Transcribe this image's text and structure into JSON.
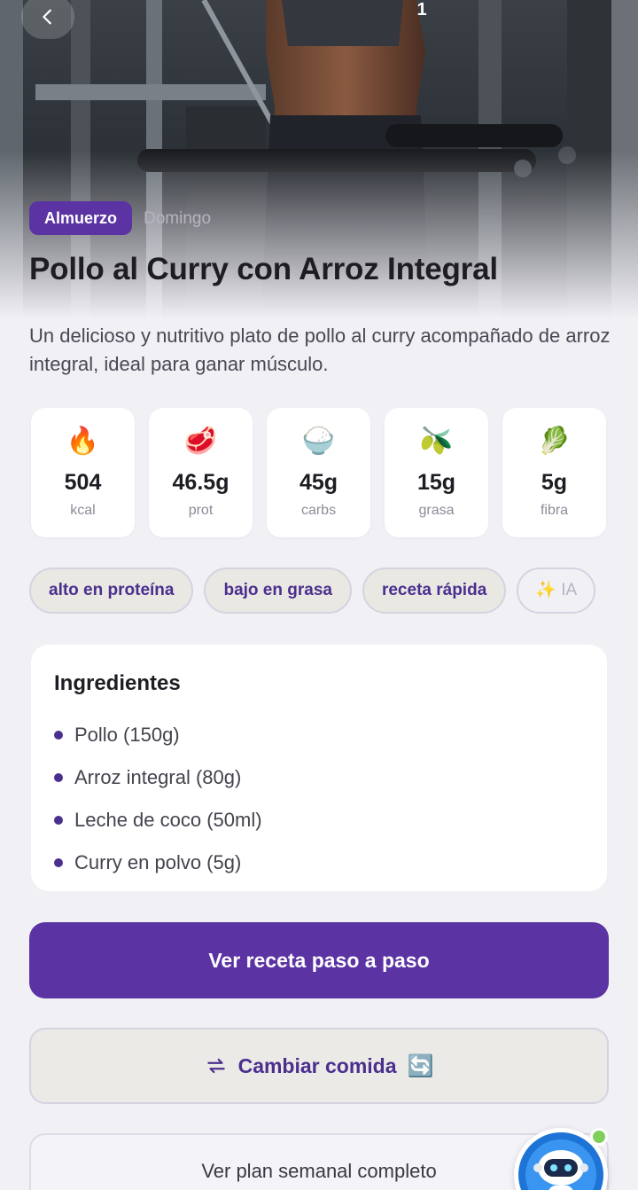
{
  "hero": {
    "page_indicator": "1",
    "meal_type": "Almuerzo",
    "day": "Domingo",
    "title": "Pollo al Curry con Arroz Integral"
  },
  "description": "Un delicioso y nutritivo plato de pollo al curry acompañado de arroz integral, ideal para ganar músculo.",
  "macros": [
    {
      "emoji": "🔥",
      "value": "504",
      "unit": "kcal"
    },
    {
      "emoji": "🥩",
      "value": "46.5g",
      "unit": "prot"
    },
    {
      "emoji": "🍚",
      "value": "45g",
      "unit": "carbs"
    },
    {
      "emoji": "🫒",
      "value": "15g",
      "unit": "grasa"
    },
    {
      "emoji": "🥬",
      "value": "5g",
      "unit": "fibra"
    }
  ],
  "tags": [
    "alto en proteína",
    "bajo en grasa",
    "receta rápida"
  ],
  "ai_tag": "✨ IA",
  "ingredients": {
    "heading": "Ingredientes",
    "items": [
      "Pollo (150g)",
      "Arroz integral (80g)",
      "Leche de coco (50ml)",
      "Curry en polvo (5g)"
    ]
  },
  "actions": {
    "primary": "Ver receta paso a paso",
    "change": "Cambiar comida",
    "change_emoji": "🔄",
    "weekly": "Ver plan semanal completo"
  },
  "colors": {
    "accent": "#5b33a3",
    "tag_text": "#4b2f8f",
    "background": "#f1f0f5",
    "online": "#7fcf5a"
  },
  "icons": {
    "back": "chevron-left-icon",
    "change": "swap-arrows-icon",
    "assistant": "robot-avatar-icon"
  }
}
